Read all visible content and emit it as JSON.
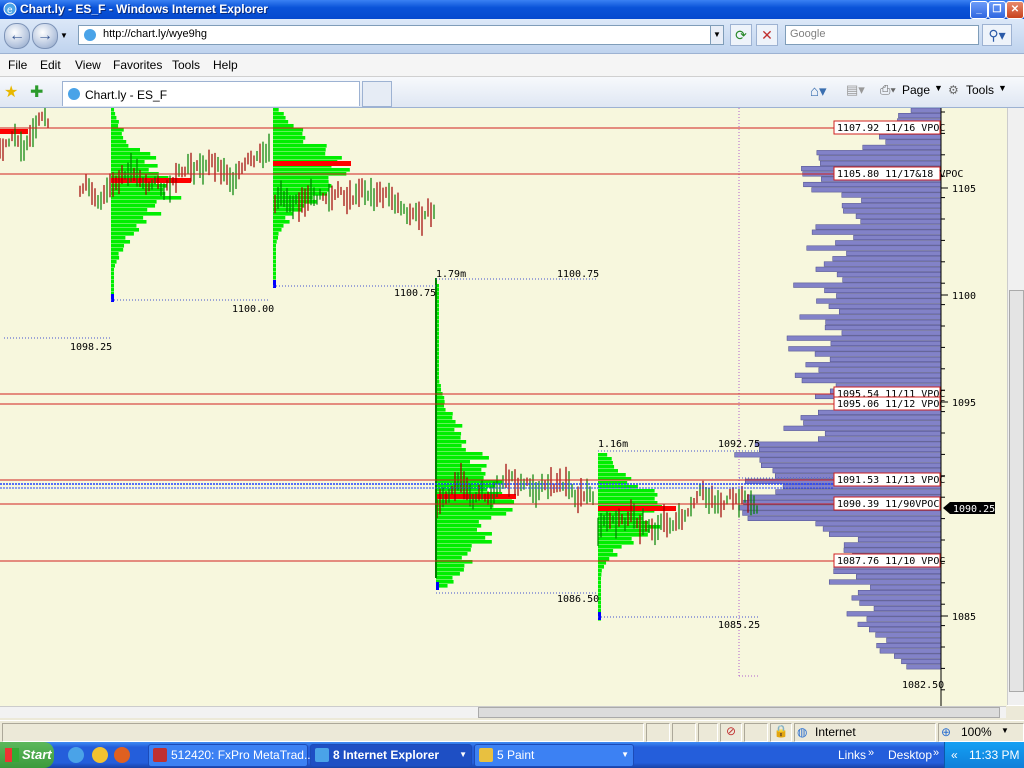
{
  "window": {
    "title": "Chart.ly - ES_F - Windows Internet Explorer"
  },
  "addressbar": {
    "url": "http://chart.ly/wye9hg",
    "search_placeholder": "Google"
  },
  "menus": [
    "File",
    "Edit",
    "View",
    "Favorites",
    "Tools",
    "Help"
  ],
  "tab": {
    "label": "Chart.ly - ES_F"
  },
  "commandbar": {
    "page_label": "Page",
    "tools_label": "Tools"
  },
  "chart": {
    "symbol": "ES_F",
    "price_axis_ticks": [
      "1105",
      "1100",
      "1095",
      "1085"
    ],
    "current_price": "1090.25",
    "low_label": "1082.50",
    "vpoc_labels": [
      {
        "text": "1107.92 11/16 VPOC"
      },
      {
        "text": "1105.80 11/17&18 VPOC"
      },
      {
        "text": "1095.54 11/11 VPOC"
      },
      {
        "text": "1095.06 11/12 VPOC"
      },
      {
        "text": "1091.53 11/13 VPOC"
      },
      {
        "text": "1090.39 11/90VPOC"
      },
      {
        "text": "1087.76 11/10 VPOC"
      }
    ],
    "annotations": [
      {
        "text": "1098.25"
      },
      {
        "text": "1100.00"
      },
      {
        "text": "1100.75"
      },
      {
        "text": "1.79m"
      },
      {
        "text": "1100.75"
      },
      {
        "text": "1.16m"
      },
      {
        "text": "1092.75"
      },
      {
        "text": "1086.50"
      },
      {
        "text": "1085.25"
      }
    ],
    "colors": {
      "background": "#f7f7dd",
      "profile": "#00ee00",
      "vpoc": "#ff0000",
      "volume_profile": "#8282c8",
      "up_bar": "#008000",
      "down_bar": "#a00000"
    }
  },
  "statusbar": {
    "zone": "Internet",
    "zoom": "100%"
  },
  "taskbar": {
    "start": "Start",
    "buttons": [
      {
        "label": "512420: FxPro MetaTrad...",
        "active": false
      },
      {
        "label": "8 Internet Explorer",
        "active": true
      },
      {
        "label": "5 Paint",
        "active": false
      }
    ],
    "links_label": "Links",
    "desktop_label": "Desktop",
    "time": "11:33 PM"
  }
}
